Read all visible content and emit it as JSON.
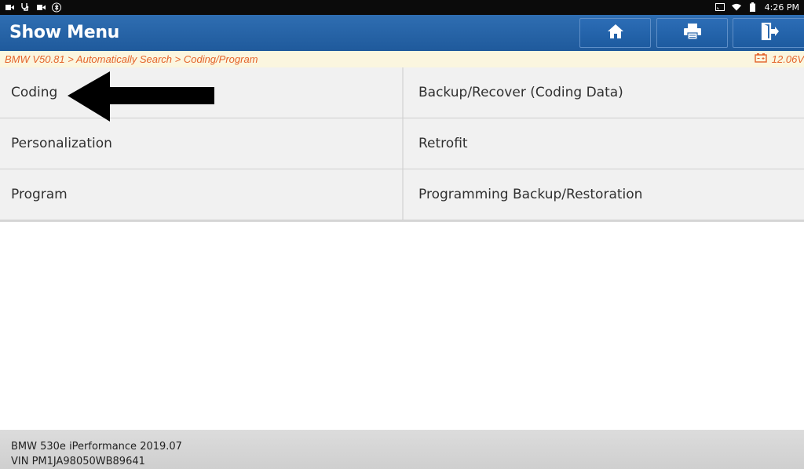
{
  "status_bar": {
    "time": "4:26 PM"
  },
  "header": {
    "title": "Show Menu"
  },
  "toolbar": {
    "home_icon": "home-icon",
    "print_icon": "printer-icon",
    "exit_icon": "exit-icon"
  },
  "breadcrumb": {
    "path": "BMW V50.81 > Automatically Search > Coding/Program",
    "voltage": "12.06V"
  },
  "menu": {
    "items": [
      {
        "label": "Coding"
      },
      {
        "label": "Backup/Recover (Coding Data)"
      },
      {
        "label": "Personalization"
      },
      {
        "label": "Retrofit"
      },
      {
        "label": "Program"
      },
      {
        "label": "Programming Backup/Restoration"
      }
    ]
  },
  "vehicle": {
    "model": "BMW 530e iPerformance 2019.07",
    "vin": "VIN PM1JA98050WB89641"
  },
  "colors": {
    "header": "#2f6eb2",
    "breadcrumb_text": "#e4632a",
    "menu_cell": "#f1f1f1"
  }
}
